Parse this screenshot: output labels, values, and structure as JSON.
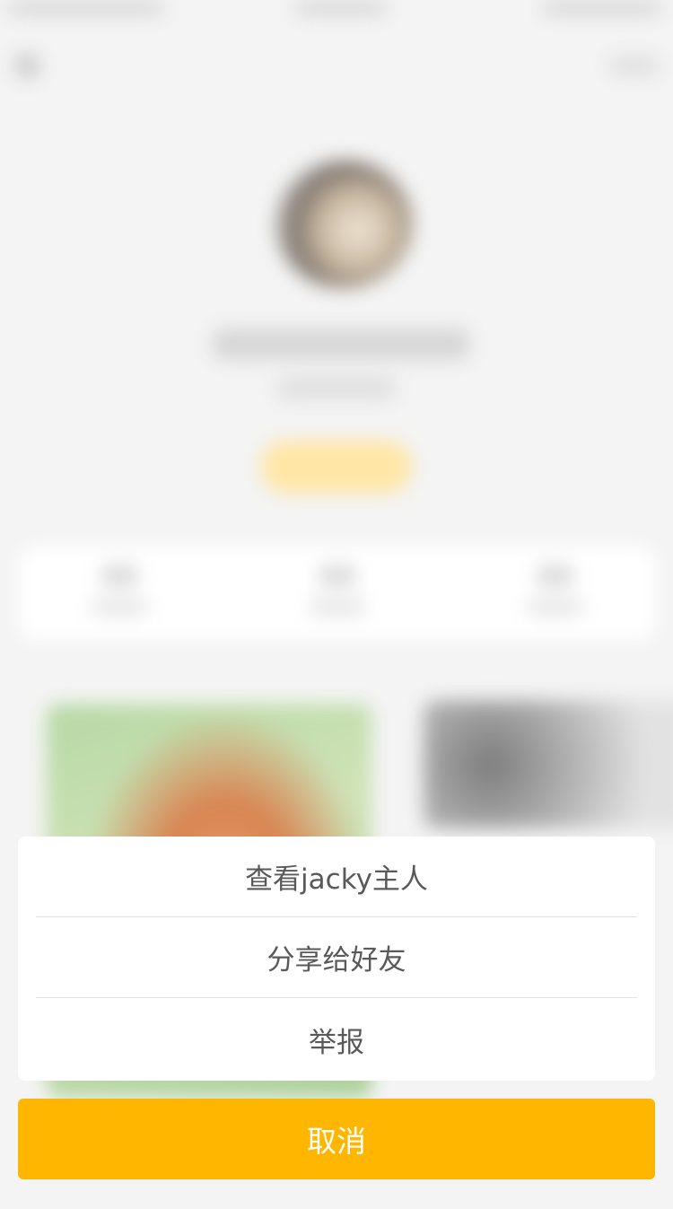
{
  "colors": {
    "accent": "#ffb600",
    "sheet_background": "#ffffff",
    "sheet_text": "#595959",
    "cancel_text": "#ffffff"
  },
  "action_sheet": {
    "items": [
      {
        "label": "查看jacky主人"
      },
      {
        "label": "分享给好友"
      },
      {
        "label": "举报"
      }
    ]
  },
  "cancel_button": {
    "label": "取消"
  },
  "background_icons": [
    "back-arrow-icon",
    "more-icon"
  ]
}
